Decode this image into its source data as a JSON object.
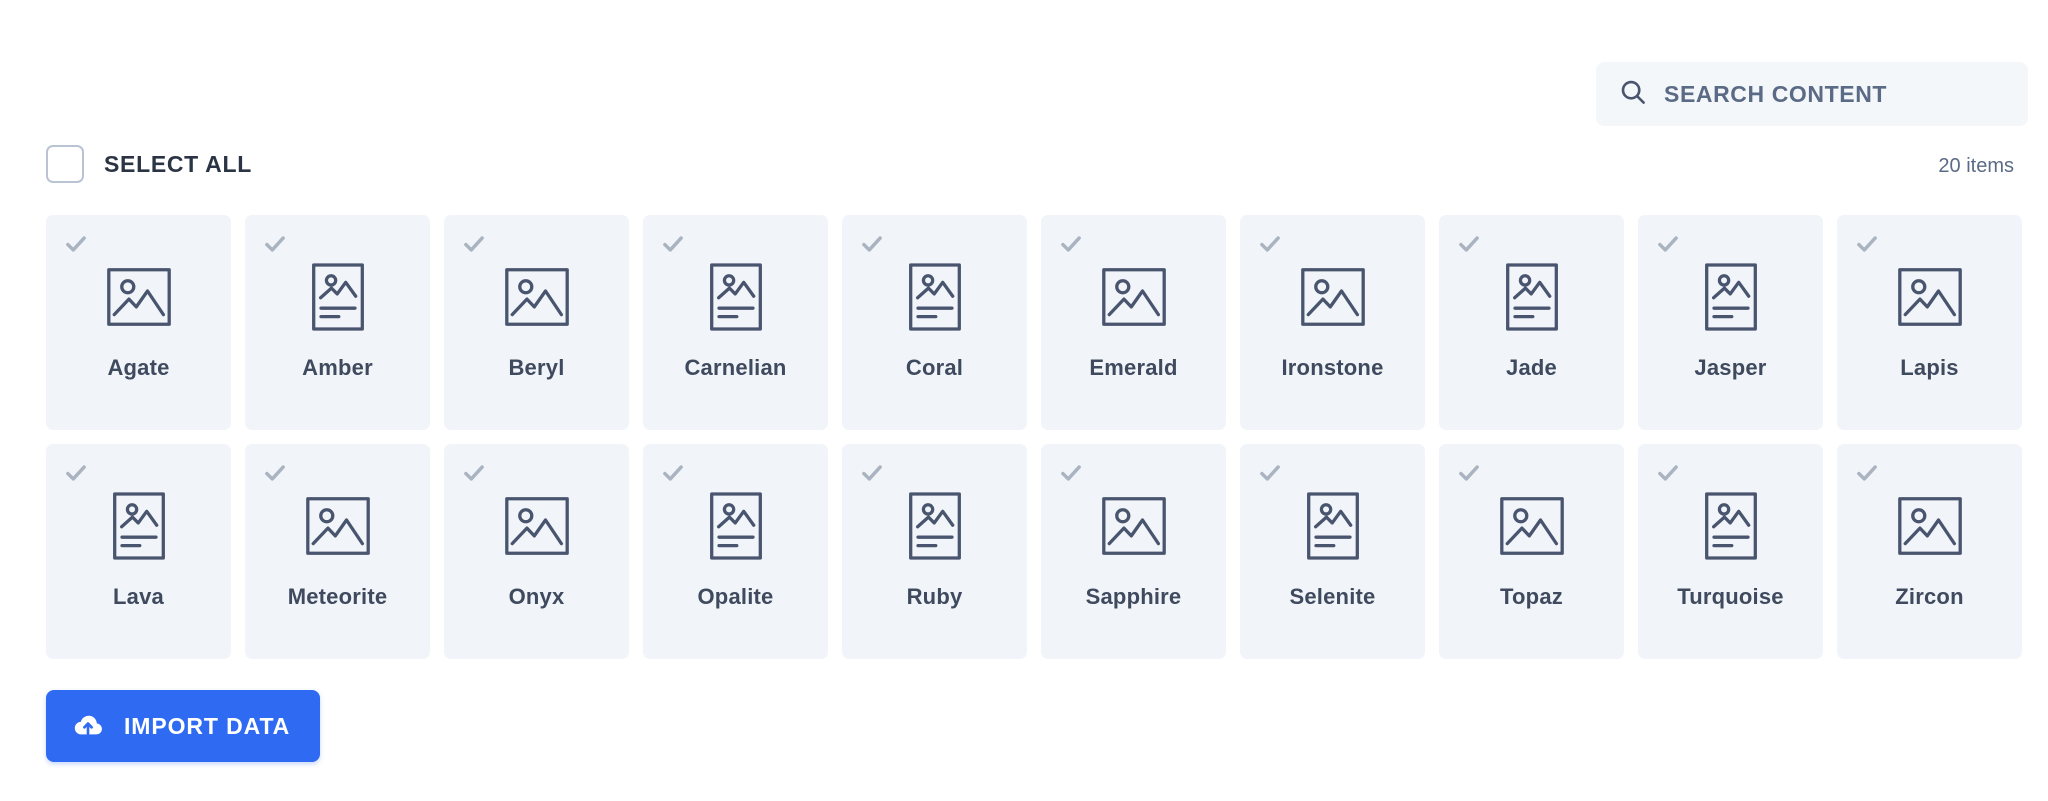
{
  "search": {
    "placeholder": "SEARCH CONTENT",
    "value": "",
    "icon": "search-icon"
  },
  "toolbar": {
    "select_all_label": "SELECT ALL",
    "select_all_checked": false,
    "items_count_text": "20 items"
  },
  "footer": {
    "import_label": "IMPORT DATA",
    "import_icon": "cloud-upload-icon"
  },
  "colors": {
    "accent": "#2f6af3",
    "card_bg": "#f1f5f9",
    "search_bg": "#f4f7fa",
    "label_text": "#3f4a5f",
    "muted_text": "#5b6b86",
    "check_gray": "#aab3c0",
    "icon_stroke": "#49556e",
    "checkbox_border": "#b9c3d3"
  },
  "grid": {
    "columns": 10,
    "items": [
      {
        "label": "Agate",
        "icon": "image-icon",
        "checked": true
      },
      {
        "label": "Amber",
        "icon": "article-icon",
        "checked": true
      },
      {
        "label": "Beryl",
        "icon": "image-icon",
        "checked": true
      },
      {
        "label": "Carnelian",
        "icon": "article-icon",
        "checked": true
      },
      {
        "label": "Coral",
        "icon": "article-icon",
        "checked": true
      },
      {
        "label": "Emerald",
        "icon": "image-icon",
        "checked": true
      },
      {
        "label": "Ironstone",
        "icon": "image-icon",
        "checked": true
      },
      {
        "label": "Jade",
        "icon": "article-icon",
        "checked": true
      },
      {
        "label": "Jasper",
        "icon": "article-icon",
        "checked": true
      },
      {
        "label": "Lapis",
        "icon": "image-icon",
        "checked": true
      },
      {
        "label": "Lava",
        "icon": "article-icon",
        "checked": true
      },
      {
        "label": "Meteorite",
        "icon": "image-icon",
        "checked": true
      },
      {
        "label": "Onyx",
        "icon": "image-icon",
        "checked": true
      },
      {
        "label": "Opalite",
        "icon": "article-icon",
        "checked": true
      },
      {
        "label": "Ruby",
        "icon": "article-icon",
        "checked": true
      },
      {
        "label": "Sapphire",
        "icon": "image-icon",
        "checked": true
      },
      {
        "label": "Selenite",
        "icon": "article-icon",
        "checked": true
      },
      {
        "label": "Topaz",
        "icon": "image-icon",
        "checked": true
      },
      {
        "label": "Turquoise",
        "icon": "article-icon",
        "checked": true
      },
      {
        "label": "Zircon",
        "icon": "image-icon",
        "checked": true
      }
    ]
  }
}
